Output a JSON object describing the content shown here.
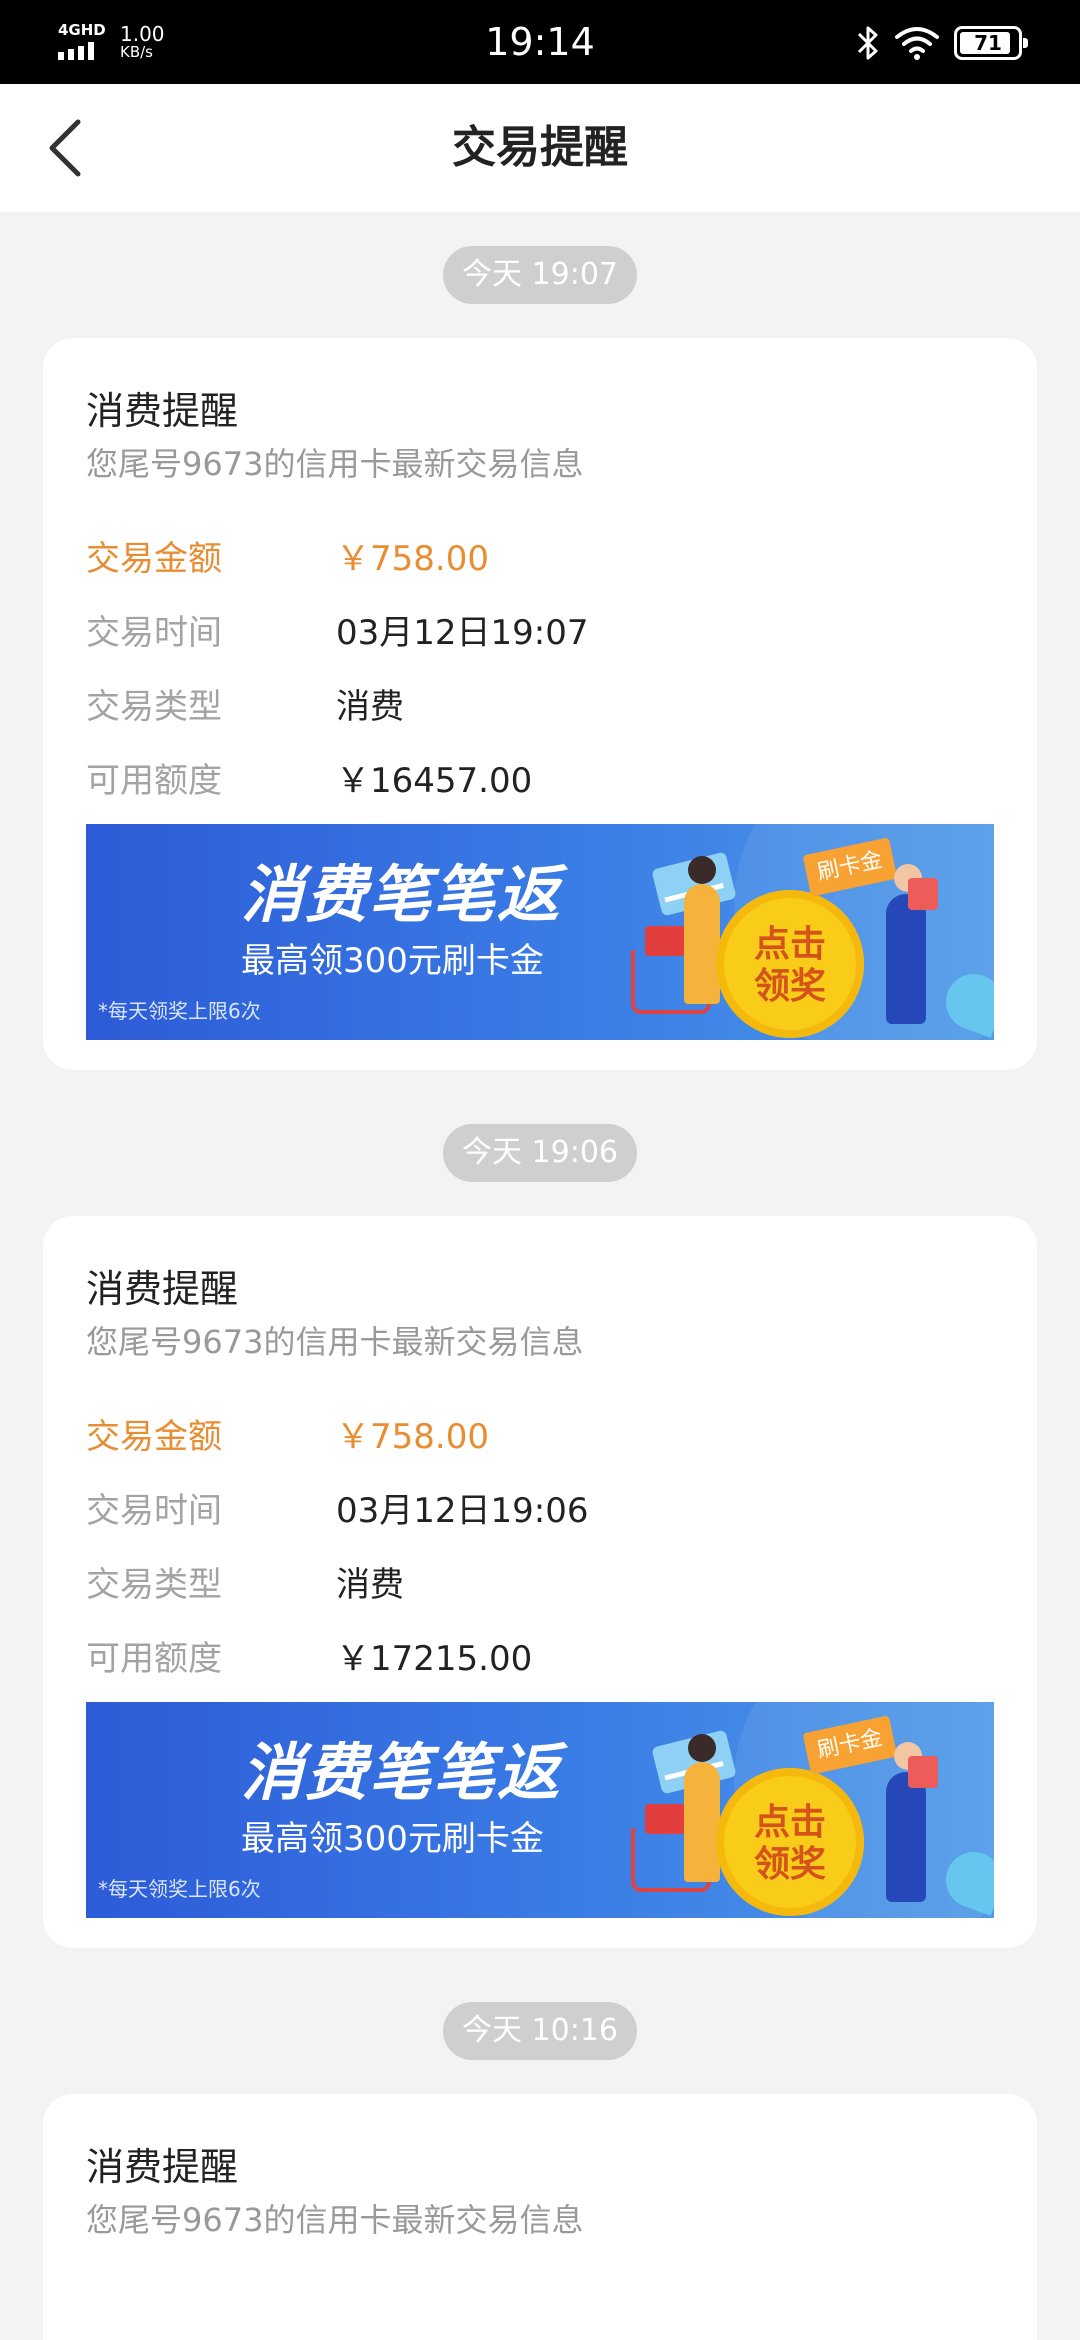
{
  "status_bar": {
    "network": "4GHD",
    "speed_value": "1.00",
    "speed_unit": "KB/s",
    "time": "19:14",
    "battery": "71"
  },
  "header": {
    "title": "交易提醒",
    "back_icon": "chevron-left-icon"
  },
  "labels": {
    "amount": "交易金额",
    "time": "交易时间",
    "type": "交易类型",
    "available": "可用额度"
  },
  "banner": {
    "title": "消费笔笔返",
    "subtitle": "最高领300元刷卡金",
    "note": "*每天领奖上限6次",
    "button": "点击领奖",
    "tag": "刷卡金"
  },
  "messages": [
    {
      "timestamp": "今天 19:07",
      "title": "消费提醒",
      "subtitle": "您尾号9673的信用卡最新交易信息",
      "amount": "￥758.00",
      "time": "03月12日19:07",
      "type": "消费",
      "available": "￥16457.00"
    },
    {
      "timestamp": "今天 19:06",
      "title": "消费提醒",
      "subtitle": "您尾号9673的信用卡最新交易信息",
      "amount": "￥758.00",
      "time": "03月12日19:06",
      "type": "消费",
      "available": "￥17215.00"
    },
    {
      "timestamp": "今天 10:16",
      "title": "消费提醒",
      "subtitle": "您尾号9673的信用卡最新交易信息"
    }
  ],
  "colors": {
    "accent": "#e88d32",
    "background": "#f3f3f3",
    "timestamp_pill": "#cfcfcf",
    "banner_blue": "#2d5bd7"
  }
}
